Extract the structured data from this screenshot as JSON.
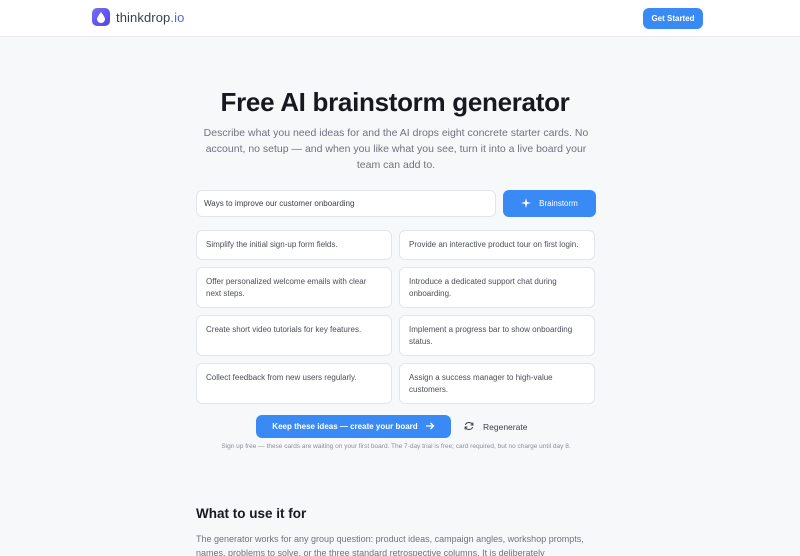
{
  "nav": {
    "logo_main": "thinkdrop",
    "logo_tld": ".io",
    "cta_label": "Get Started"
  },
  "hero": {
    "title": "Free AI brainstorm generator",
    "subtitle": "Describe what you need ideas for and the AI drops eight concrete starter cards. No account, no setup — and when you like what you see, turn it into a live board your team can add to."
  },
  "generator": {
    "input_value": "Ways to improve our customer onboarding",
    "button_label": "Brainstorm",
    "cards": [
      "Simplify the initial sign-up form fields.",
      "Provide an interactive product tour on first login.",
      "Offer personalized welcome emails with clear next steps.",
      "Introduce a dedicated support chat during onboarding.",
      "Create short video tutorials for key features.",
      "Implement a progress bar to show onboarding status.",
      "Collect feedback from new users regularly.",
      "Assign a success manager to high-value customers."
    ],
    "keep_label": "Keep these ideas — create your board",
    "regenerate_label": "Regenerate",
    "fineprint": "Sign up free — these cards are waiting on your first board. The 7-day trial is free; card required, but no charge until day 8."
  },
  "usage": {
    "title": "What to use it for",
    "body": "The generator works for any group question: product ideas, campaign angles, workshop prompts, names, problems to solve, or the three standard retrospective columns. It is deliberately"
  },
  "colors": {
    "accent": "#3a8af5",
    "logo": "#5b50e8",
    "background": "#f7f8fa"
  }
}
